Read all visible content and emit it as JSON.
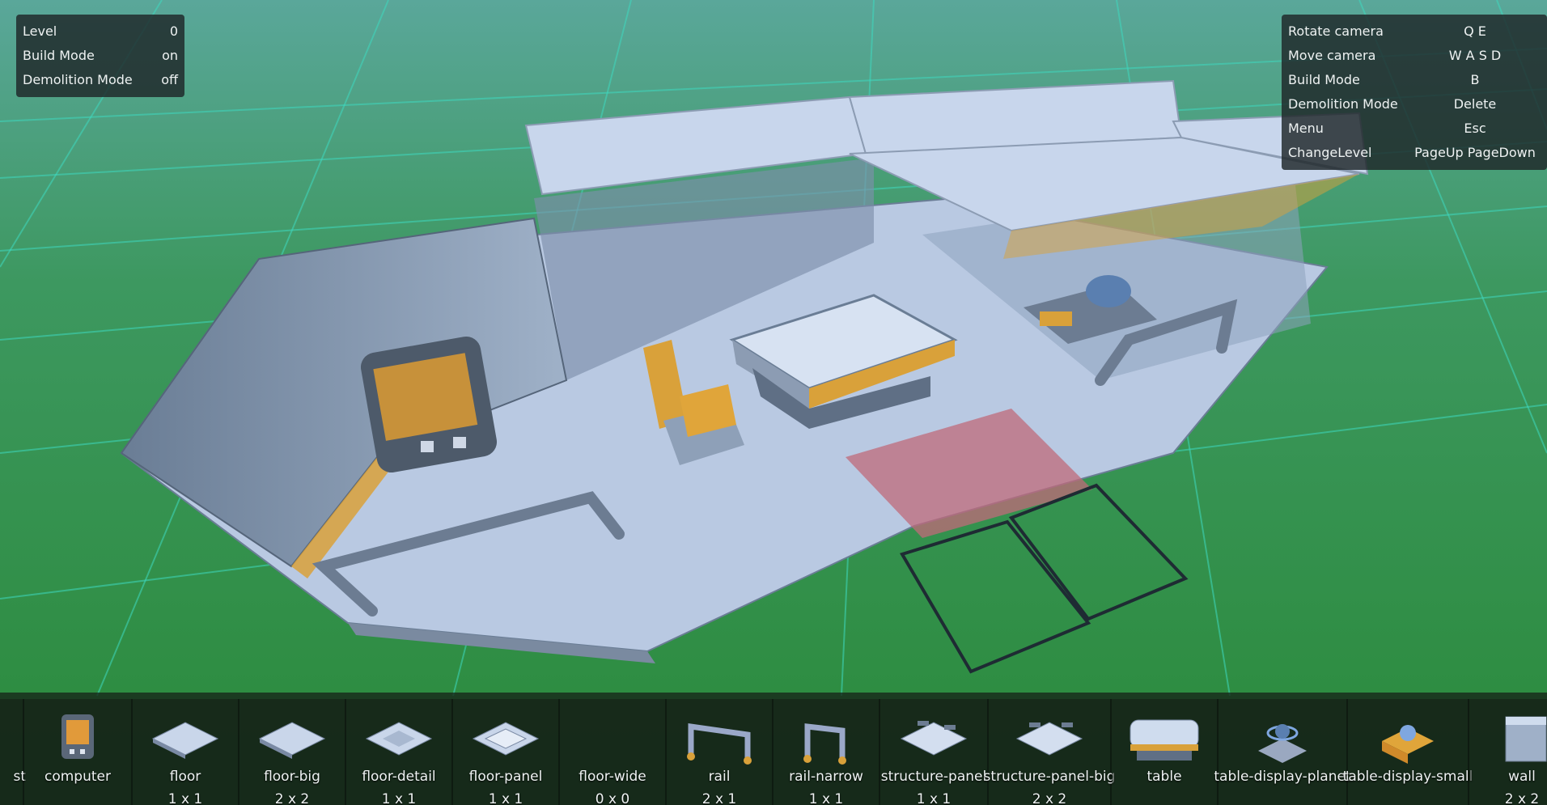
{
  "hud_status": {
    "rows": [
      {
        "label": "Level",
        "value": "0"
      },
      {
        "label": "Build Mode",
        "value": "on"
      },
      {
        "label": "Demolition Mode",
        "value": "off"
      }
    ]
  },
  "hud_controls": {
    "rows": [
      {
        "label": "Rotate camera",
        "value": "Q E"
      },
      {
        "label": "Move camera",
        "value": "W A S D"
      },
      {
        "label": "Build Mode",
        "value": "B"
      },
      {
        "label": "Demolition Mode",
        "value": "Delete"
      },
      {
        "label": "Menu",
        "value": "Esc"
      },
      {
        "label": "ChangeLevel",
        "value": "PageUp PageDown"
      }
    ]
  },
  "toolbar": {
    "items": [
      {
        "name": "st",
        "size": "",
        "icon": "partial-item-icon"
      },
      {
        "name": "computer",
        "size": "",
        "icon": "computer-icon"
      },
      {
        "name": "floor",
        "size": "1 x 1",
        "icon": "floor-icon"
      },
      {
        "name": "floor-big",
        "size": "2 x 2",
        "icon": "floor-big-icon"
      },
      {
        "name": "floor-detail",
        "size": "1 x 1",
        "icon": "floor-detail-icon"
      },
      {
        "name": "floor-panel",
        "size": "1 x 1",
        "icon": "floor-panel-icon"
      },
      {
        "name": "floor-wide",
        "size": "0 x 0",
        "icon": ""
      },
      {
        "name": "rail",
        "size": "2 x 1",
        "icon": "rail-icon"
      },
      {
        "name": "rail-narrow",
        "size": "1 x 1",
        "icon": "rail-narrow-icon"
      },
      {
        "name": "structure-panel",
        "size": "1 x 1",
        "icon": "structure-panel-icon"
      },
      {
        "name": "structure-panel-big",
        "size": "2 x 2",
        "icon": "structure-panel-big-icon"
      },
      {
        "name": "table",
        "size": "",
        "icon": "table-icon"
      },
      {
        "name": "table-display-planet",
        "size": "",
        "icon": "table-display-planet-icon"
      },
      {
        "name": "table-display-small",
        "size": "",
        "icon": "table-display-small-icon"
      },
      {
        "name": "wall",
        "size": "2 x 2",
        "icon": "wall-icon"
      }
    ]
  },
  "colors": {
    "ground": "#2f8a3f",
    "grid": "#3ed8c0",
    "structure": "#c3d3ea",
    "accent": "#d9a13a",
    "demolish_highlight": "#c06a7a"
  }
}
